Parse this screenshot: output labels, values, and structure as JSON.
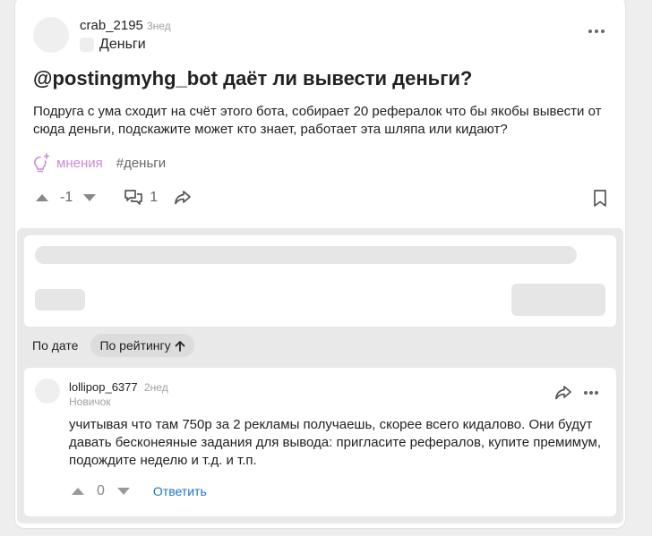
{
  "post": {
    "author": "crab_2195",
    "time": "3нед",
    "community": "Деньги",
    "title": "@postingmyhg_bot даёт ли вывести деньги?",
    "body": "Подруга с ума сходит на счёт этого бота, собирает 20 рефералок что бы якобы вывести от сюда деньги, подскажите может кто знает, работает эта шляпа или кидают?",
    "tags": {
      "special": "мнения",
      "tag": "#деньги"
    },
    "score": "-1",
    "comment_count": "1"
  },
  "sort": {
    "by_date": "По дате",
    "by_rating": "По рейтингу"
  },
  "comment": {
    "author": "lollipop_6377",
    "time": "2нед",
    "rank": "Новичок",
    "text": "учитывая что там 750р за 2 рекламы получаешь, скорее всего кидалово. Они будут давать бесконеяные задания для вывода: пригласите рефералов, купите премимум, подождите неделю и т.д. и т.п.",
    "score": "0",
    "reply_label": "Ответить"
  },
  "colors": {
    "accent_link": "#1a73c8",
    "tag_special": "#c98ad8"
  }
}
